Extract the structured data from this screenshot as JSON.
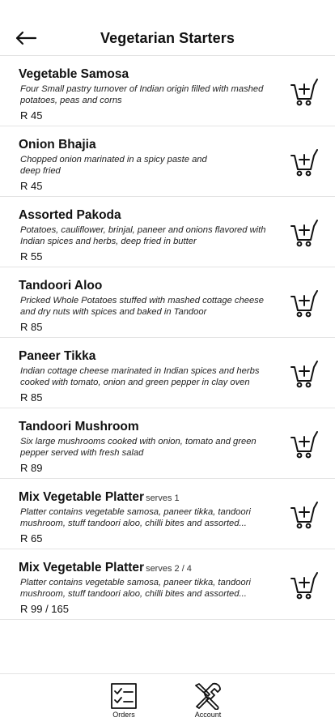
{
  "header": {
    "title": "Vegetarian Starters",
    "back_icon": "arrow-left-icon"
  },
  "items": [
    {
      "name": "Vegetable Samosa",
      "serves": "",
      "description": "Four Small pastry turnover of Indian origin filled with mashed potatoes, peas and corns",
      "price": "R 45"
    },
    {
      "name": "Onion Bhajia",
      "serves": "",
      "description": "Chopped onion marinated in a spicy paste and deep fried",
      "price": "R 45"
    },
    {
      "name": "Assorted Pakoda",
      "serves": "",
      "description": "Potatoes, cauliflower, brinjal, paneer and onions flavored with Indian spices and herbs, deep fried in butter",
      "price": "R 55"
    },
    {
      "name": "Tandoori Aloo",
      "serves": "",
      "description": "Pricked Whole Potatoes stuffed with mashed cottage cheese and dry nuts with spices and baked in Tandoor",
      "price": "R 85"
    },
    {
      "name": "Paneer Tikka",
      "serves": "",
      "description": "Indian cottage cheese marinated in Indian spices and herbs cooked with tomato, onion and green pepper in clay oven",
      "price": "R 85"
    },
    {
      "name": "Tandoori Mushroom",
      "serves": "",
      "description": "Six large mushrooms cooked with onion, tomato and green pepper served with fresh salad",
      "price": "R 89"
    },
    {
      "name": "Mix Vegetable Platter",
      "serves": "serves 1",
      "description": "Platter contains vegetable samosa, paneer tikka, tandoori mushroom, stuff tandoori aloo, chilli bites and assorted...",
      "price": "R 65"
    },
    {
      "name": "Mix Vegetable Platter",
      "serves": "serves 2 / 4",
      "description": "Platter contains vegetable samosa, paneer tikka, tandoori mushroom, stuff tandoori aloo, chilli bites and assorted...",
      "price": "R 99 / 165"
    }
  ],
  "cart_icon": "add-to-cart-icon",
  "bottom_nav": {
    "orders_label": "Orders",
    "orders_icon": "checklist-icon",
    "account_label": "Account",
    "account_icon": "tools-icon"
  }
}
